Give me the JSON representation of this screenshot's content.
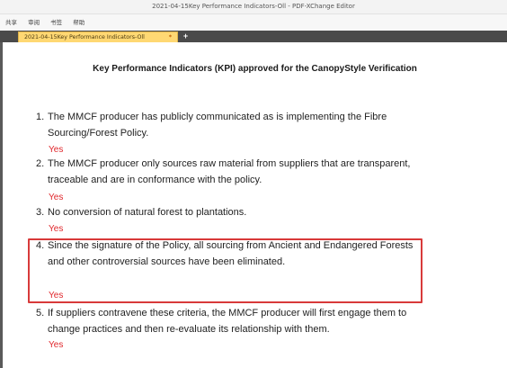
{
  "window": {
    "title": "2021-04-15Key Performance Indicators-Oll - PDF-XChange Editor"
  },
  "menu": {
    "items": [
      "共享",
      "审阅",
      "书签",
      "帮助"
    ]
  },
  "tabs": {
    "active_label": "2021-04-15Key Performance Indicators-Oll",
    "close_glyph": "*",
    "new_tab_glyph": "+"
  },
  "document": {
    "title": "Key Performance Indicators (KPI) approved for the CanopyStyle Verification",
    "items": [
      {
        "number": "1.",
        "text": "The MMCF producer has publicly communicated as is implementing the Fibre Sourcing/Forest Policy.",
        "answer": "Yes"
      },
      {
        "number": "2.",
        "text": "The MMCF producer only sources raw material from suppliers that are transparent, traceable and are in conformance with the policy.",
        "answer": "Yes"
      },
      {
        "number": "3.",
        "text": "No conversion of natural forest to plantations.",
        "answer": "Yes"
      },
      {
        "number": "4.",
        "text": "Since the signature of the Policy, all sourcing from Ancient and Endangered Forests and other controversial sources have been eliminated.",
        "answer": "Yes"
      },
      {
        "number": "5.",
        "text": "If suppliers contravene these criteria, the MMCF producer will first engage them to change practices and then re-evaluate its relationship with them.",
        "answer": "Yes"
      }
    ]
  },
  "colors": {
    "answer": "#e0262b",
    "highlight_border": "#d83a3a",
    "active_tab": "#ffd873"
  }
}
